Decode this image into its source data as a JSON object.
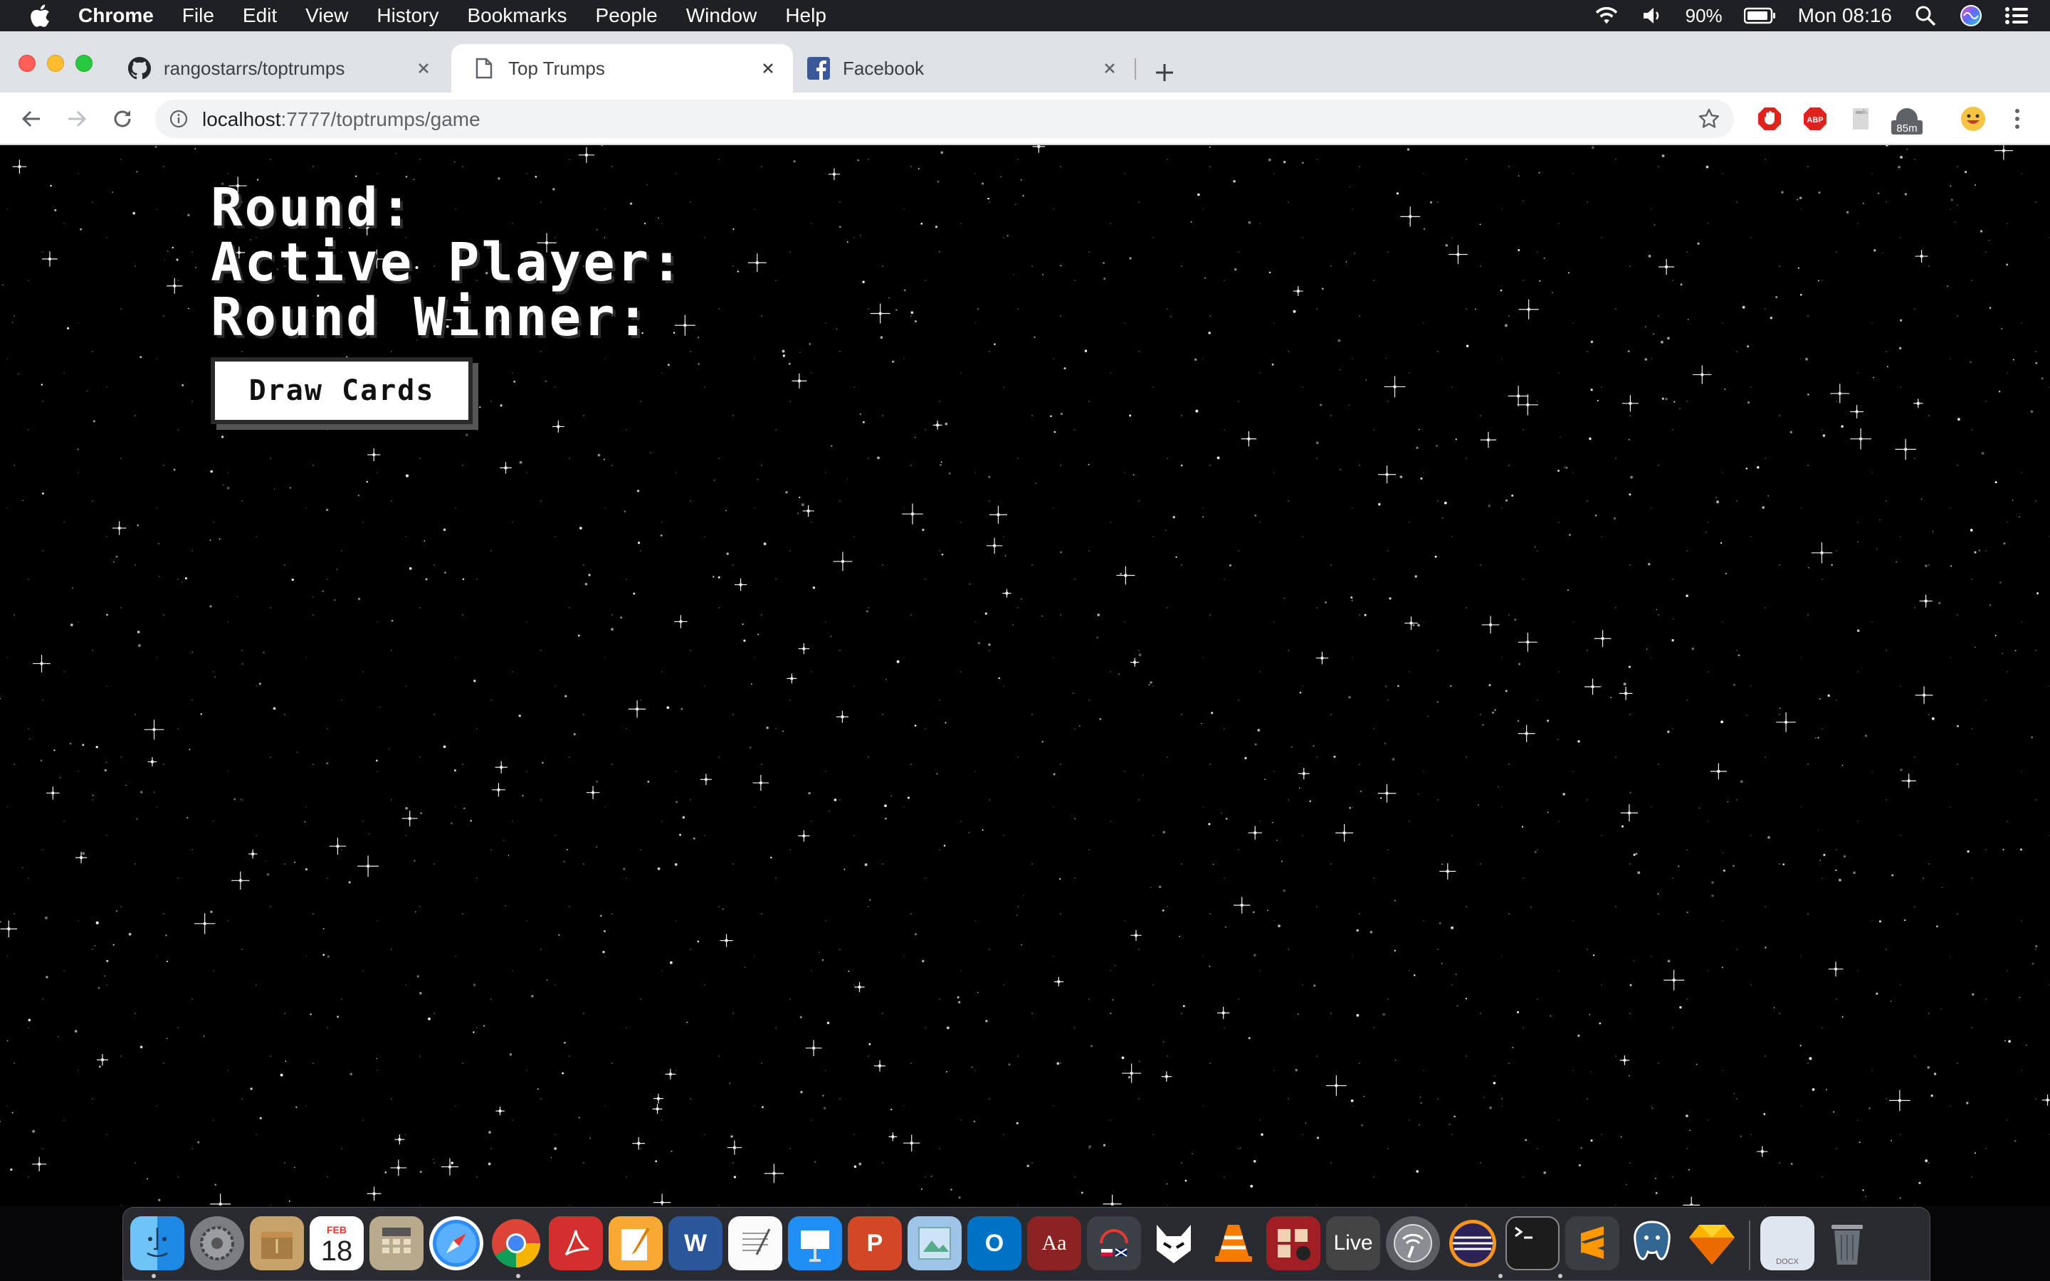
{
  "menubar": {
    "app_name": "Chrome",
    "items": [
      "File",
      "Edit",
      "View",
      "History",
      "Bookmarks",
      "People",
      "Window",
      "Help"
    ],
    "battery": "90%",
    "clock": "Mon 08:16"
  },
  "tabs": [
    {
      "title": "rangostarrs/toptrumps",
      "icon": "github-icon"
    },
    {
      "title": "Top Trumps",
      "icon": "page-icon",
      "active": true
    },
    {
      "title": "Facebook",
      "icon": "facebook-icon"
    }
  ],
  "toolbar": {
    "url_host": "localhost",
    "url_path": ":7777/toptrumps/game",
    "extension_badge": "85m"
  },
  "game": {
    "round_label": "Round:",
    "active_player_label": "Active Player:",
    "round_winner_label": "Round Winner:",
    "draw_button_label": "Draw Cards"
  },
  "dock": {
    "apps": [
      "Finder",
      "System Preferences",
      "Archive Utility",
      "Calendar",
      "Calculator",
      "Safari",
      "Google Chrome",
      "Adobe Acrobat",
      "Pages",
      "Microsoft Word",
      "TextEdit",
      "Keynote",
      "Microsoft PowerPoint",
      "Preview",
      "Microsoft Outlook",
      "Dictionary",
      "Translator",
      "Alfred",
      "VLC",
      "Photo Booth",
      "Live",
      "Wireless",
      "Eclipse",
      "Terminal",
      "Sublime Text",
      "PostgreSQL",
      "Sketch",
      "Documents",
      "Trash"
    ],
    "calendar_month": "FEB",
    "calendar_day": "18",
    "live_label": "Live",
    "dictionary_label": "Aa",
    "docs_label": "DOCX"
  }
}
